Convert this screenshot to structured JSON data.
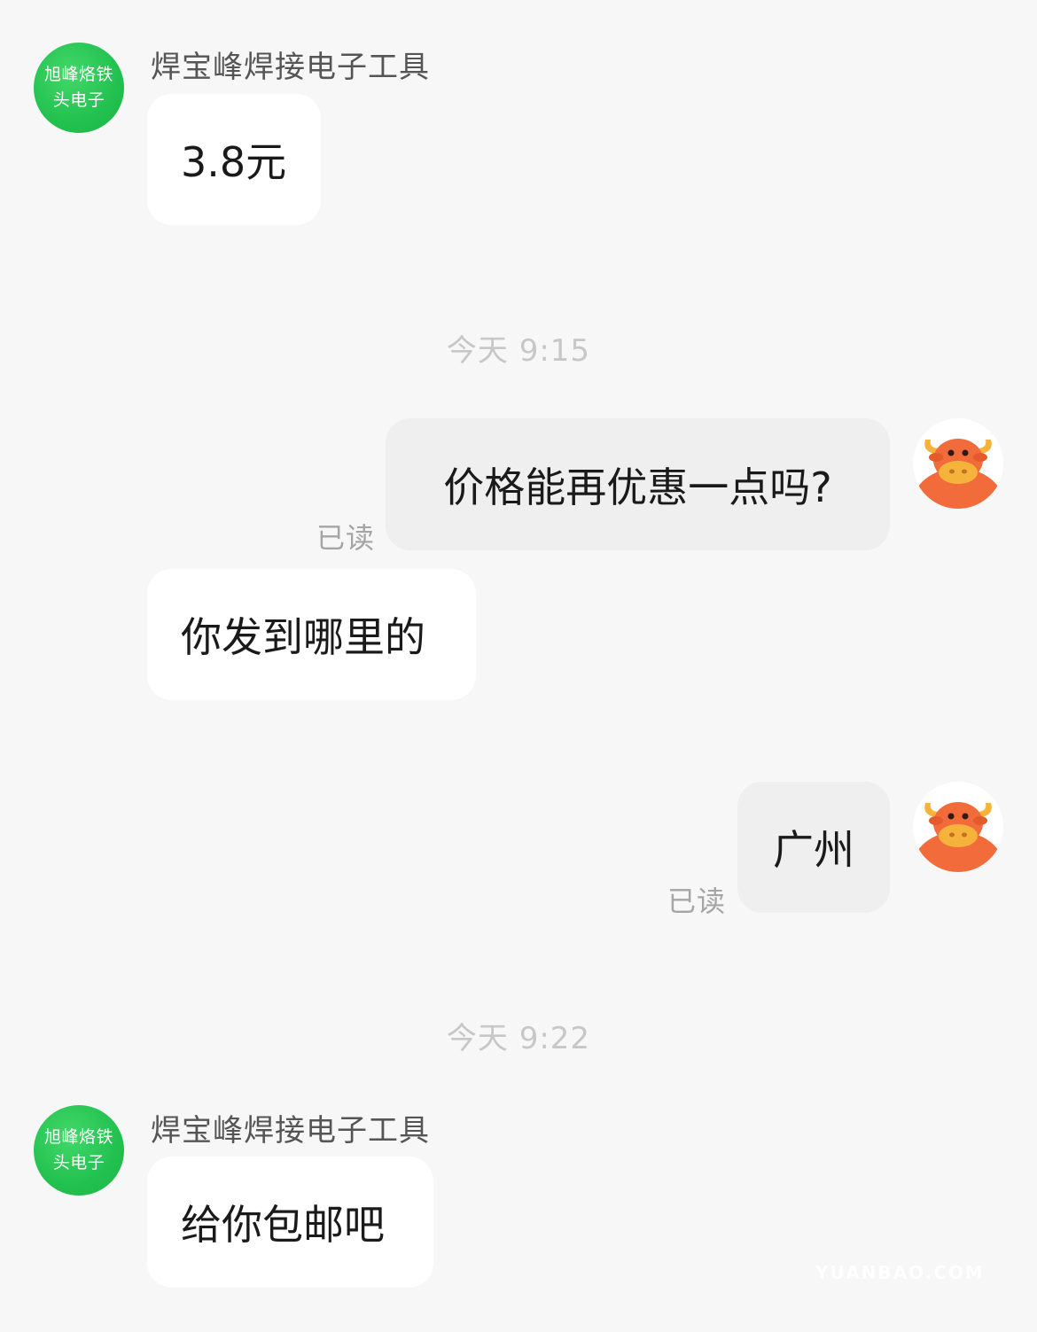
{
  "shop": {
    "avatar_line1": "旭峰烙铁",
    "avatar_line2": "头电子",
    "name": "焊宝峰焊接电子工具",
    "color": "#22c14f"
  },
  "messages": {
    "m1": "3.8元",
    "ts1": "今天 9:15",
    "m2": "价格能再优惠一点吗?",
    "m2_status": "已读",
    "m3": "你发到哪里的",
    "m4": "广州",
    "m4_status": "已读",
    "ts2": "今天 9:22",
    "m5": "给你包邮吧"
  },
  "user_avatar": {
    "icon": "cow-avatar-icon",
    "color": "#f26b3a"
  },
  "watermark": "YUANBAO.COM"
}
